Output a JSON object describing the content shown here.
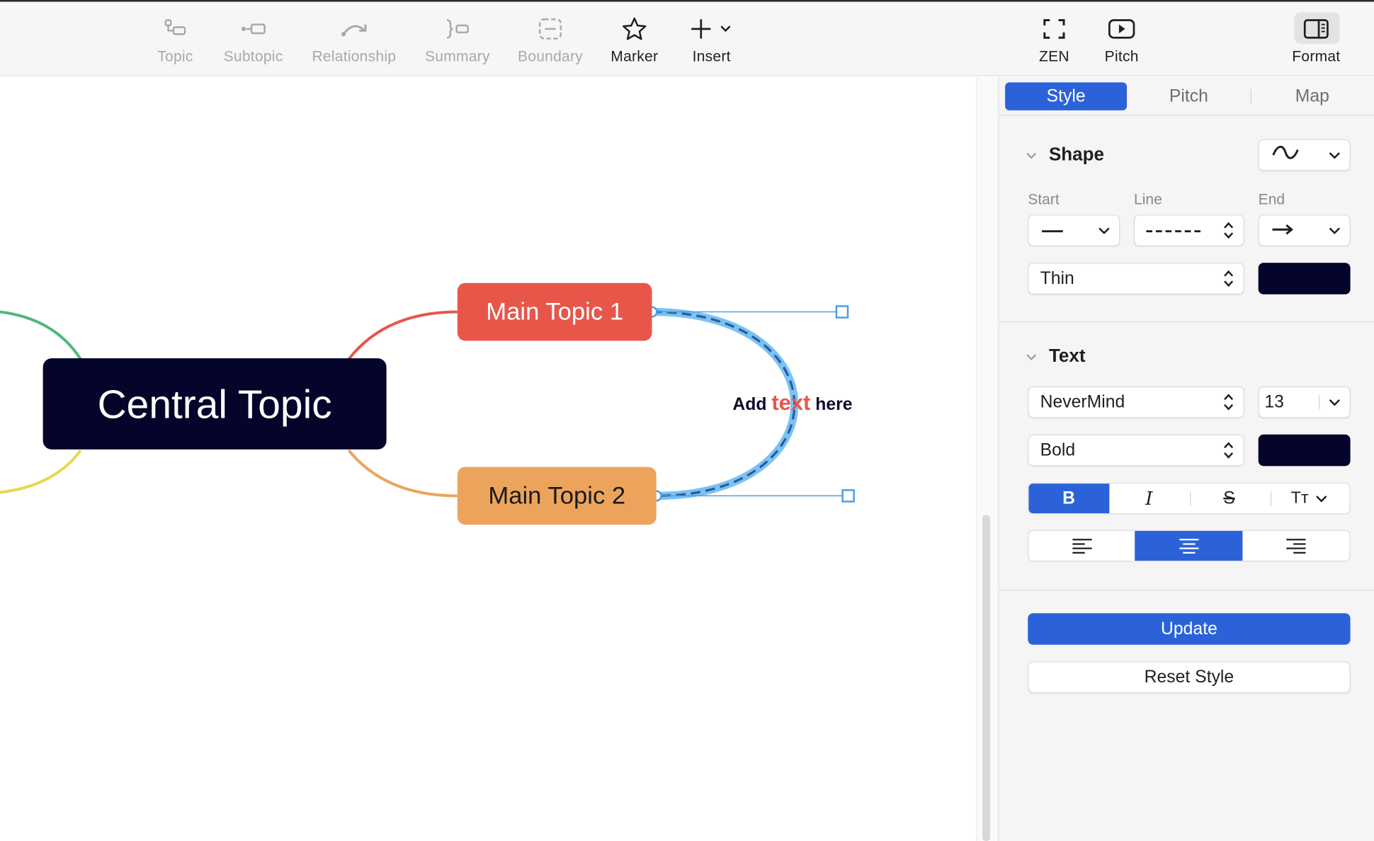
{
  "toolbar": {
    "items": [
      {
        "label": "Topic",
        "icon": "topic-icon",
        "enabled": false
      },
      {
        "label": "Subtopic",
        "icon": "subtopic-icon",
        "enabled": false
      },
      {
        "label": "Relationship",
        "icon": "relationship-icon",
        "enabled": false
      },
      {
        "label": "Summary",
        "icon": "summary-icon",
        "enabled": false
      },
      {
        "label": "Boundary",
        "icon": "boundary-icon",
        "enabled": false
      },
      {
        "label": "Marker",
        "icon": "star-icon",
        "enabled": true
      },
      {
        "label": "Insert",
        "icon": "plus-icon",
        "enabled": true
      }
    ],
    "right_items": [
      {
        "label": "ZEN",
        "icon": "zen-fullscreen-icon"
      },
      {
        "label": "Pitch",
        "icon": "pitch-play-icon"
      },
      {
        "label": "Format",
        "icon": "format-panel-icon",
        "active": true
      }
    ]
  },
  "canvas": {
    "central_topic": "Central Topic",
    "main_topic_1": "Main Topic 1",
    "main_topic_2": "Main Topic 2",
    "relationship_label": {
      "before": "Add",
      "accent": "text",
      "after": "here"
    }
  },
  "panel": {
    "tabs": [
      {
        "label": "Style",
        "active": true
      },
      {
        "label": "Pitch",
        "active": false
      },
      {
        "label": "Map",
        "active": false
      }
    ],
    "shape": {
      "title": "Shape",
      "curve_icon": "curve-icon",
      "start_label": "Start",
      "line_label": "Line",
      "end_label": "End",
      "start_icon": "solid-line-icon",
      "line_icon": "dashed-line-icon",
      "end_icon": "arrow-end-icon",
      "thickness": "Thin",
      "color": "#05052b"
    },
    "text": {
      "title": "Text",
      "font": "NeverMind",
      "size": "13",
      "weight": "Bold",
      "color": "#05052b",
      "format_buttons": [
        "B",
        "I",
        "S",
        "Tт"
      ],
      "active_format": "B",
      "align_active": "center"
    },
    "update_label": "Update",
    "reset_label": "Reset Style"
  },
  "colors": {
    "accent": "#2c62d9",
    "central": "#05052b",
    "main1": "#e8564a",
    "main2": "#eca45c",
    "relationship": "#5fb4f0"
  }
}
